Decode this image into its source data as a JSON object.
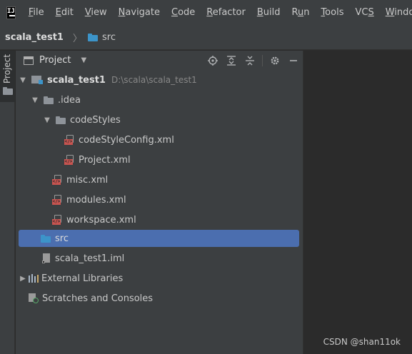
{
  "app": {
    "logo_text": "IJ"
  },
  "menu": [
    "File",
    "Edit",
    "View",
    "Navigate",
    "Code",
    "Refactor",
    "Build",
    "Run",
    "Tools",
    "VCS",
    "Window"
  ],
  "menu_mnemonics": [
    "F",
    "E",
    "V",
    "N",
    "C",
    "R",
    "B",
    "u",
    "T",
    "S",
    "W"
  ],
  "breadcrumb": {
    "project": "scala_test1",
    "separator": "〉",
    "folder": "src"
  },
  "toolstrip": {
    "tab_label": "Project"
  },
  "panel": {
    "title": "Project",
    "tools": [
      "locate-icon",
      "expand-all-icon",
      "collapse-all-icon",
      "gear-icon",
      "minimize-icon"
    ]
  },
  "tree": [
    {
      "label": "scala_test1",
      "path": "D:\\scala\\scala_test1",
      "type": "module",
      "depth": 0,
      "expanded": true
    },
    {
      "label": ".idea",
      "type": "folder",
      "depth": 1,
      "expanded": true
    },
    {
      "label": "codeStyles",
      "type": "folder",
      "depth": 2,
      "expanded": true
    },
    {
      "label": "codeStyleConfig.xml",
      "type": "xml",
      "depth": 3
    },
    {
      "label": "Project.xml",
      "type": "xml",
      "depth": 3
    },
    {
      "label": "misc.xml",
      "type": "xml",
      "depth": 2
    },
    {
      "label": "modules.xml",
      "type": "xml",
      "depth": 2
    },
    {
      "label": "workspace.xml",
      "type": "xml",
      "depth": 2
    },
    {
      "label": "src",
      "type": "source-folder",
      "depth": 1,
      "selected": true
    },
    {
      "label": "scala_test1.iml",
      "type": "iml",
      "depth": 1
    },
    {
      "label": "External Libraries",
      "type": "libraries",
      "depth": 0,
      "expanded": false
    },
    {
      "label": "Scratches and Consoles",
      "type": "scratches",
      "depth": 0
    }
  ],
  "watermark": "CSDN @shan11ok",
  "colors": {
    "selection": "#4b6eaf",
    "source_folder": "#3c94c9",
    "xml_badge": "#c75450",
    "panel_bg": "#3c3f41",
    "editor_bg": "#2b2b2b"
  }
}
